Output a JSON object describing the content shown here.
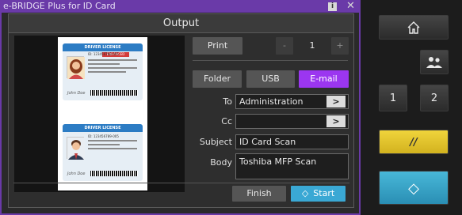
{
  "background_app": {
    "title": "e-BRIDGE Plus for ID Card",
    "info_label": "i",
    "close_label": "✕"
  },
  "dialog": {
    "title": "Output",
    "print_label": "Print",
    "minus_label": "-",
    "copies": "1",
    "plus_label": "+",
    "tabs": [
      {
        "label": "Folder",
        "active": false
      },
      {
        "label": "USB",
        "active": false
      },
      {
        "label": "E-mail",
        "active": true
      }
    ],
    "fields": {
      "to_label": "To",
      "to_value": "Administration",
      "cc_label": "Cc",
      "cc_value": "",
      "subject_label": "Subject",
      "subject_value": "ID Card Scan",
      "body_label": "Body",
      "body_value": "Toshiba MFP Scan"
    },
    "arrow_label": ">",
    "finish_label": "Finish",
    "start_label": "Start",
    "start_icon": "◇"
  },
  "preview": {
    "card_front": {
      "header": "DRIVER LICENSE",
      "stripe": "ENHANCED",
      "id_line": "ID: 123456789-005",
      "sig": "John Doe"
    },
    "card_back": {
      "header": "DRIVER LICENSE",
      "id_line": "ID: 123456789-005",
      "sig": "John Doe"
    }
  },
  "panel": {
    "home_icon": "home-icon",
    "user_icon": "user-switch-icon",
    "key1": "1",
    "key2": "2",
    "interrupt_label": "//",
    "start_icon": "◇",
    "colors": {
      "interrupt": "#e6c62a",
      "start": "#3aa8c8",
      "accent": "#9b36f0"
    }
  }
}
